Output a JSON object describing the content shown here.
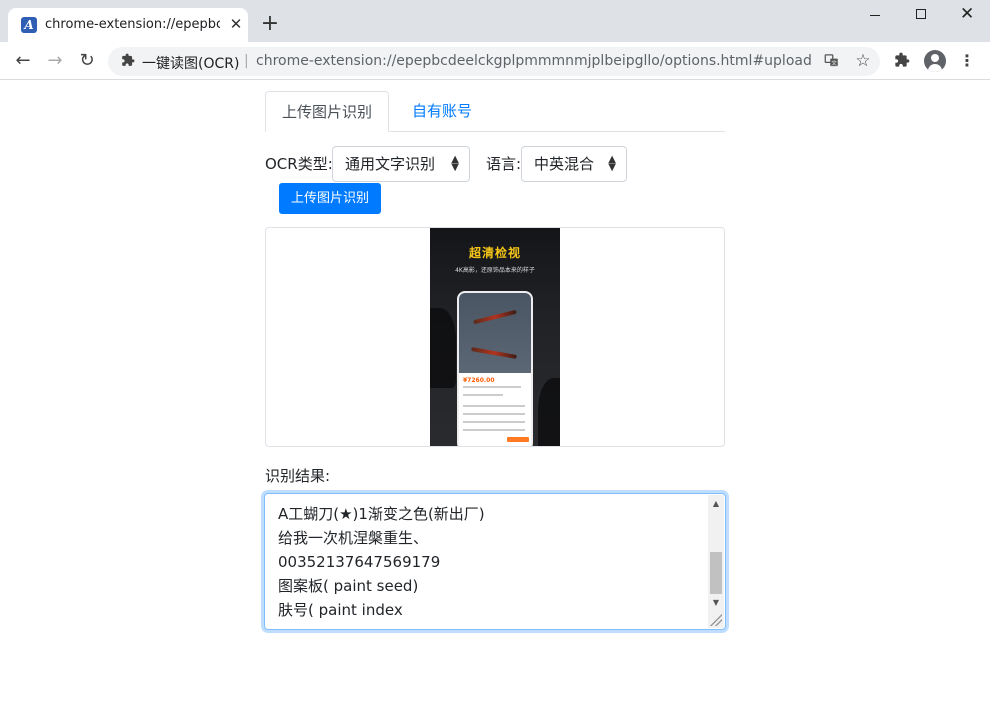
{
  "browser": {
    "tab_title": "chrome-extension://epepbcde",
    "tab_favicon": "A",
    "tab_close": "✕",
    "new_tab": "+",
    "window_close": "✕"
  },
  "toolbar": {
    "back": "←",
    "forward": "→",
    "reload": "↻",
    "omnibox_label": "一键读图(OCR)",
    "omnibox_sep": "|",
    "url": "chrome-extension://epepbcdeelckgplpmmmnmjplbeipgllo/options.html#upload",
    "star": "☆",
    "menu": "⋮"
  },
  "tabs": [
    {
      "label": "上传图片识别",
      "active": true
    },
    {
      "label": "自有账号",
      "active": false
    }
  ],
  "form": {
    "ocr_type_label": "OCR类型:",
    "ocr_type_value": "通用文字识别",
    "language_label": "语言:",
    "language_value": "中英混合",
    "upload_button": "上传图片识别"
  },
  "preview": {
    "poster_title": "超清检视",
    "poster_subtitle": "4K高影，还原饰品本来的样子",
    "price": "¥7260.00"
  },
  "result": {
    "label": "识别结果:",
    "text": "A工蝴刀(★)1渐变之色(新出厂)\n给我一次机涅槃重生、\n00352137647569179\n图案板( paint seed)\n肤号( paint index"
  },
  "icons": {
    "extension": "puzzle-icon",
    "translate": "translate-icon",
    "avatar": "profile-icon"
  }
}
